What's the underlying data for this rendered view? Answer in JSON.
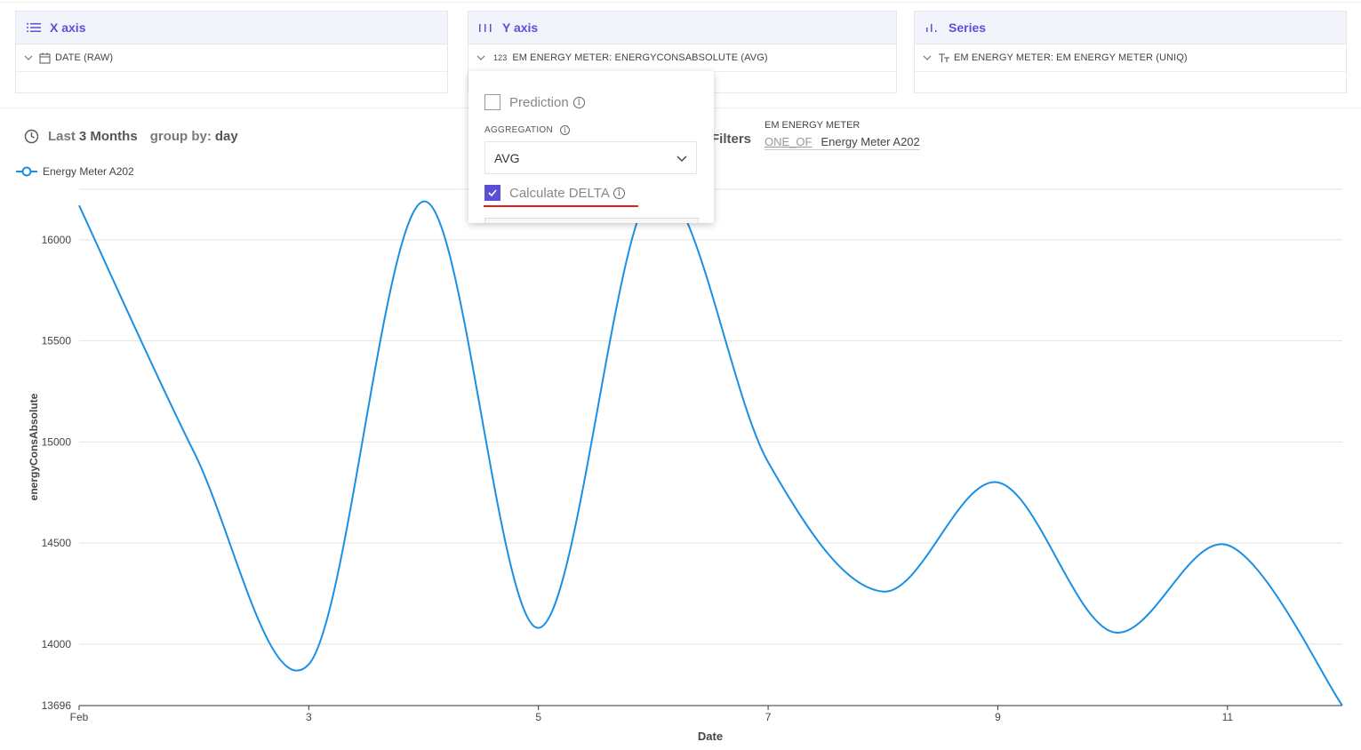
{
  "panels": {
    "x_axis": {
      "title": "X axis",
      "field": "DATE (RAW)"
    },
    "y_axis": {
      "title": "Y axis",
      "field_type": "123",
      "field": "EM ENERGY METER: ENERGYCONSABSOLUTE (AVG)"
    },
    "series": {
      "title": "Series",
      "field": "EM ENERGY METER: EM ENERGY METER (UNIQ)"
    }
  },
  "time_range": {
    "prefix": "Last",
    "value": "3 Months",
    "group_label": "group by:",
    "group_value": "day"
  },
  "filters": {
    "label": "Filters",
    "field": "EM ENERGY METER",
    "operator": "ONE_OF",
    "value": "Energy Meter A202"
  },
  "dropdown": {
    "prediction_label": "Prediction",
    "prediction_checked": false,
    "aggregation_label": "AGGREGATION",
    "aggregation_value": "AVG",
    "delta_label": "Calculate DELTA",
    "delta_checked": true
  },
  "colors": {
    "accent": "#5b4fd8",
    "line": "#1a8fe3",
    "underline": "#e2201e"
  },
  "chart_data": {
    "type": "line",
    "xlabel": "Date",
    "ylabel": "energyConsAbsolute",
    "x_ticks": [
      "Feb",
      "3",
      "5",
      "7",
      "9",
      "11"
    ],
    "y_ticks": [
      13696,
      14000,
      14500,
      15000,
      15500,
      16000
    ],
    "ylim": [
      13696,
      16250
    ],
    "legend_position": "top-left",
    "grid": true,
    "series": [
      {
        "name": "Energy Meter A202",
        "x": [
          "Feb 1",
          "Feb 2",
          "Feb 3",
          "Feb 4",
          "Feb 5",
          "Feb 6",
          "Feb 7",
          "Feb 8",
          "Feb 9",
          "Feb 10",
          "Feb 11",
          "Feb 12"
        ],
        "values": [
          16170,
          14950,
          13900,
          16190,
          14080,
          16250,
          14900,
          14260,
          14800,
          14060,
          14490,
          13696
        ]
      }
    ]
  }
}
